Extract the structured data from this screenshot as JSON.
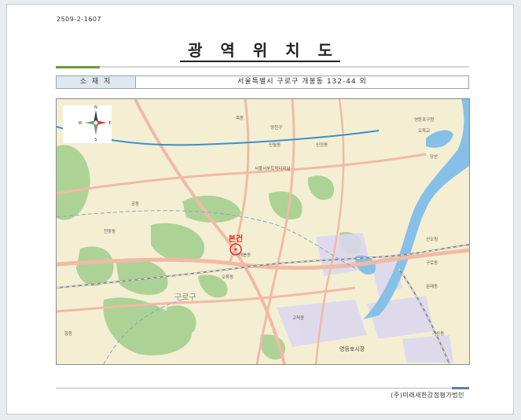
{
  "document": {
    "number": "2509-2-1607",
    "title": "광 역 위 치 도",
    "address_label": "소 재 지",
    "address_value": "서울특별시 구로구 개봉동 132-44 외",
    "company": "(주)미래새한감정평가법인"
  },
  "map": {
    "subject_label": "본건",
    "compass": {
      "n": "N",
      "s": "S",
      "e": "E",
      "w": "W"
    },
    "place_labels": [
      "목동",
      "양천구",
      "신정동",
      "신월동",
      "서울서부트럭터미널",
      "오목교",
      "영등포구청",
      "당산",
      "개봉동",
      "오류동",
      "구로구",
      "신도림",
      "구로동",
      "영등포시장",
      "문래동",
      "가산동",
      "고척동",
      "항동",
      "천왕동",
      "궁동"
    ],
    "colors": {
      "land": "#f4efd3",
      "green": "#a6cf90",
      "water": "#86c0e6",
      "urban": "#dcd7f0",
      "road": "#f2b9a6",
      "rail": "#8e8e8e",
      "subject": "#d23030"
    }
  }
}
